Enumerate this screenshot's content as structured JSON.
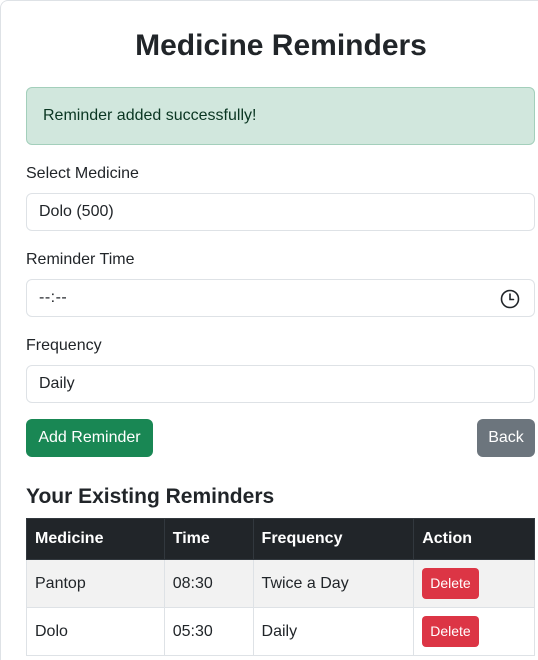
{
  "page_title": "Medicine Reminders",
  "alert": "Reminder added successfully!",
  "form": {
    "medicine_label": "Select Medicine",
    "medicine_value": "Dolo (500)",
    "time_label": "Reminder Time",
    "time_value": "--:--",
    "frequency_label": "Frequency",
    "frequency_value": "Daily",
    "add_button": "Add Reminder",
    "back_button": "Back"
  },
  "reminders": {
    "heading": "Your Existing Reminders",
    "columns": [
      "Medicine",
      "Time",
      "Frequency",
      "Action"
    ],
    "rows": [
      {
        "medicine": "Pantop",
        "time": "08:30",
        "frequency": "Twice a Day",
        "action": "Delete"
      },
      {
        "medicine": "Dolo",
        "time": "05:30",
        "frequency": "Daily",
        "action": "Delete"
      }
    ]
  },
  "colors": {
    "success": "#198754",
    "secondary": "#6c757d",
    "danger": "#dc3545",
    "alert_bg": "#d1e7dd",
    "table_header": "#212529"
  }
}
